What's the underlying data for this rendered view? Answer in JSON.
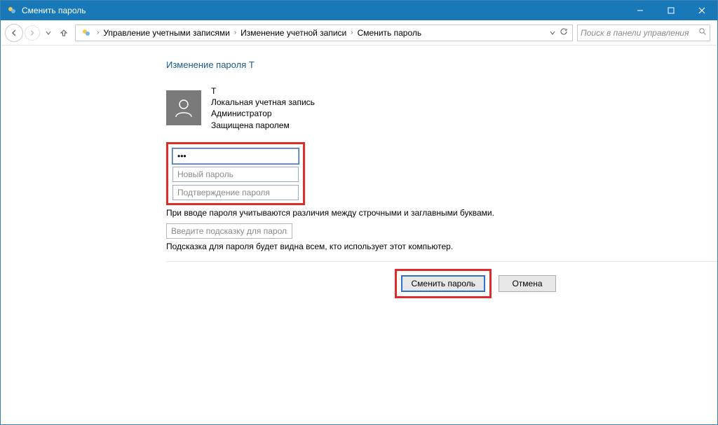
{
  "window": {
    "title": "Сменить пароль"
  },
  "breadcrumbs": {
    "0": "Управление учетными записями",
    "1": "Изменение учетной записи",
    "2": "Сменить пароль"
  },
  "search": {
    "placeholder": "Поиск в панели управления"
  },
  "page": {
    "title": "Изменение пароля Т"
  },
  "user": {
    "name": "Т",
    "type": "Локальная учетная запись",
    "role": "Администратор",
    "status": "Защищена паролем"
  },
  "passwords": {
    "current_value": "•••",
    "new_placeholder": "Новый пароль",
    "confirm_placeholder": "Подтверждение пароля"
  },
  "notes": {
    "case": "При вводе пароля учитываются различия между строчными и заглавными буквами.",
    "hint_placeholder": "Введите подсказку для пароля",
    "hint_note": "Подсказка для пароля будет видна всем, кто использует этот компьютер."
  },
  "buttons": {
    "submit": "Сменить пароль",
    "cancel": "Отмена"
  }
}
